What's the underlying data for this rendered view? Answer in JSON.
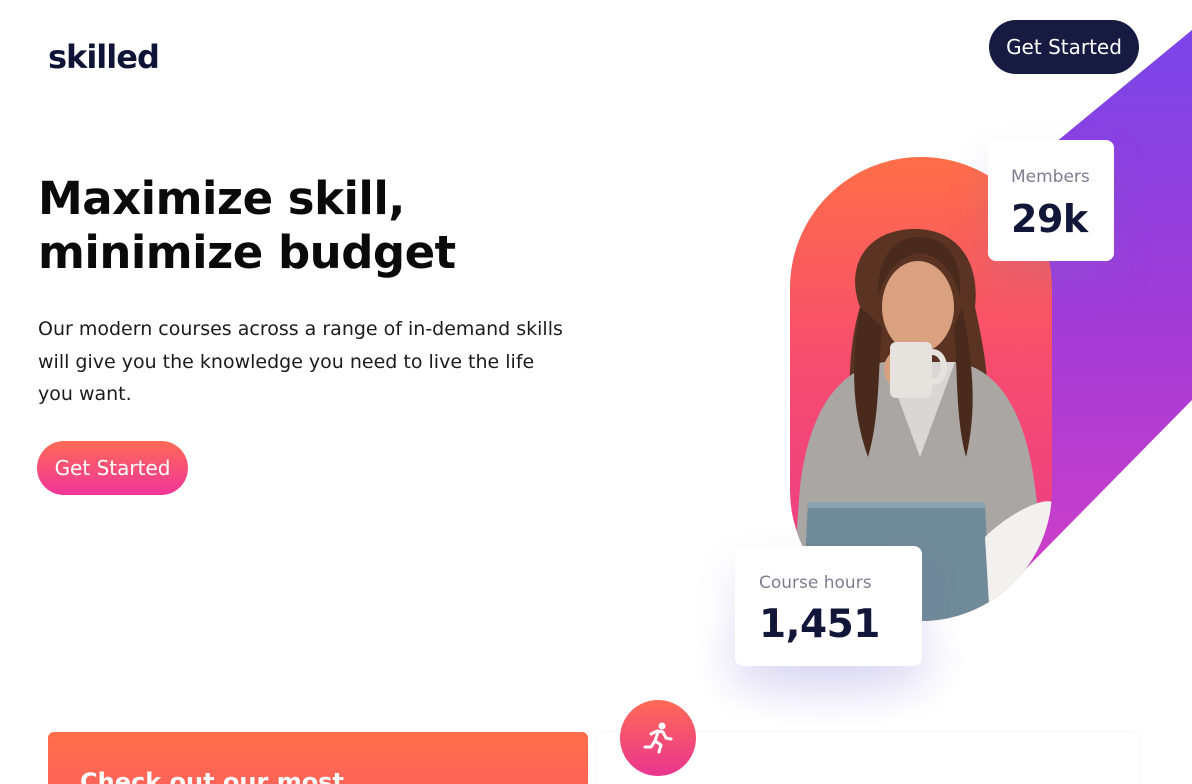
{
  "header": {
    "logo_text": "skilled",
    "cta_label": "Get Started"
  },
  "hero": {
    "title_line1": "Maximize skill,",
    "title_line2": "minimize budget",
    "body": "Our modern courses across a range of in-demand skills will give you the knowledge you need to live the life you want.",
    "cta_label": "Get Started"
  },
  "stats": {
    "members": {
      "label": "Members",
      "value": "29k"
    },
    "course_hours": {
      "label": "Course hours",
      "value": "1,451"
    }
  },
  "courses_section": {
    "card_title": "Check out our most",
    "badge_icon": "running-person-icon"
  },
  "colors": {
    "navy": "#171b42",
    "accent_orange": "#ff6a55",
    "accent_pink": "#f0359a",
    "accent_purple": "#7a45e8"
  }
}
